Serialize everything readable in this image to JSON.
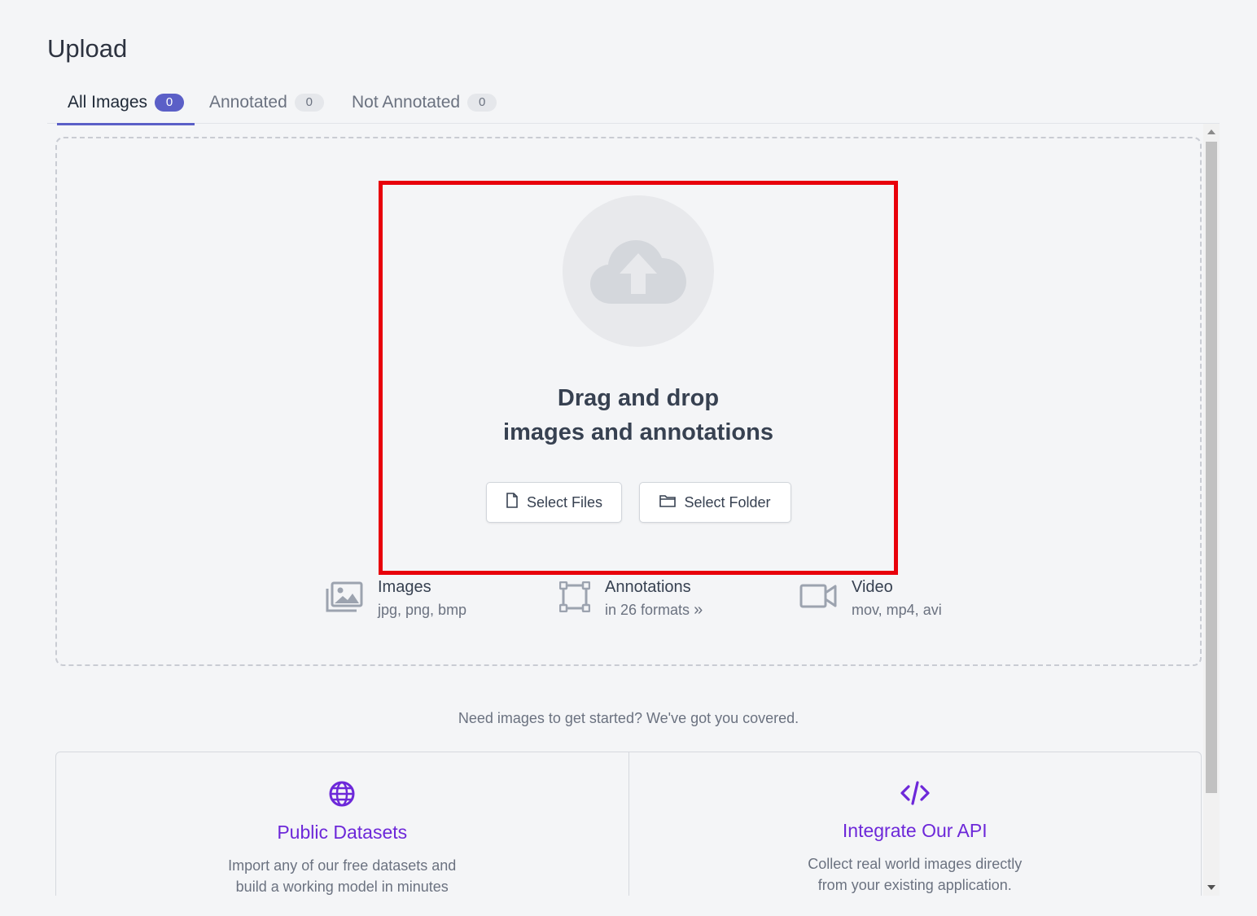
{
  "page": {
    "title": "Upload"
  },
  "tabs": [
    {
      "label": "All Images",
      "count": "0"
    },
    {
      "label": "Annotated",
      "count": "0"
    },
    {
      "label": "Not Annotated",
      "count": "0"
    }
  ],
  "dropzone": {
    "title_line1": "Drag and drop",
    "title_line2": "images and annotations",
    "select_files": "Select Files",
    "select_folder": "Select Folder",
    "icon": "cloud-upload-icon"
  },
  "formats": [
    {
      "name": "Images",
      "sub": "jpg, png, bmp",
      "icon": "images-icon"
    },
    {
      "name": "Annotations",
      "sub": "in 26 formats",
      "icon": "bounding-box-icon"
    },
    {
      "name": "Video",
      "sub": "mov, mp4, avi",
      "icon": "video-camera-icon"
    }
  ],
  "help": {
    "text": "Need images to get started? We've got you covered."
  },
  "cards": [
    {
      "title": "Public Datasets",
      "desc_line1": "Import any of our free datasets and",
      "desc_line2": "build a working model in minutes",
      "icon": "globe-icon"
    },
    {
      "title": "Integrate Our API",
      "desc_line1": "Collect real world images directly",
      "desc_line2": "from your existing application.",
      "icon": "code-icon"
    }
  ],
  "colors": {
    "accent": "#5b5fc7",
    "highlight": "#e8000b",
    "card_title": "#6d28d9"
  }
}
